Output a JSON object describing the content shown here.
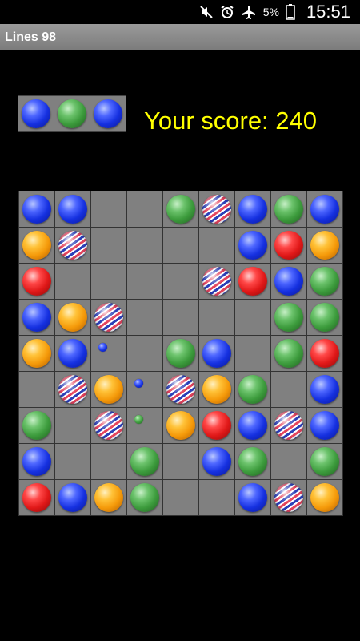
{
  "status_bar": {
    "battery_percent": "5%",
    "time": "15:51",
    "icons": [
      "mute-icon",
      "alarm-icon",
      "airplane-mode-icon",
      "battery-icon"
    ]
  },
  "app": {
    "title": "Lines 98"
  },
  "score_text": "Your score: 240",
  "colors": {
    "score": "#ffff00",
    "cell": "#808080",
    "grid_line": "#333333",
    "background": "#000000"
  },
  "next_balls": [
    "blue",
    "green",
    "blue"
  ],
  "board": {
    "size": 9,
    "rows": [
      [
        "blue",
        "blue",
        null,
        null,
        "green",
        "striped",
        "blue",
        "green",
        "blue"
      ],
      [
        "orange",
        "striped",
        null,
        null,
        null,
        null,
        "blue",
        "red",
        "orange"
      ],
      [
        "red",
        null,
        null,
        null,
        null,
        "striped",
        "red",
        "blue",
        "green"
      ],
      [
        "blue",
        "orange",
        "striped",
        null,
        null,
        null,
        null,
        "green",
        "green"
      ],
      [
        "orange",
        "blue",
        "small-blue",
        null,
        "green",
        "blue",
        null,
        "green",
        "red"
      ],
      [
        null,
        "striped",
        "orange",
        "small-blue",
        "striped",
        "orange",
        "green",
        null,
        "blue"
      ],
      [
        "green",
        null,
        "striped",
        "small-green",
        "orange",
        "red",
        "blue",
        "striped",
        "blue"
      ],
      [
        "blue",
        null,
        null,
        "green",
        null,
        "blue",
        "green",
        null,
        "green"
      ],
      [
        "red",
        "blue",
        "orange",
        "green",
        null,
        null,
        "blue",
        "striped",
        "orange"
      ]
    ]
  }
}
